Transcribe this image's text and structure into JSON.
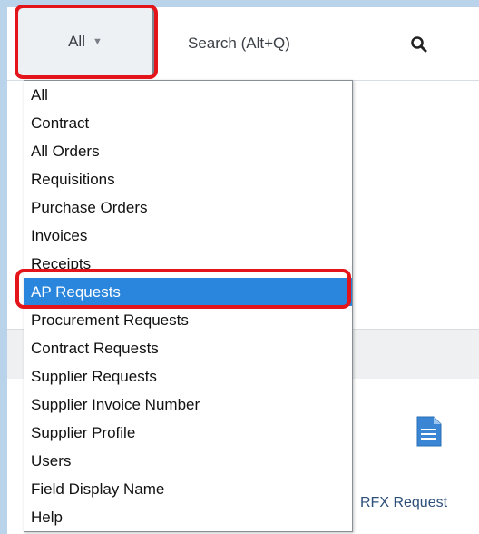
{
  "scope_selector": {
    "selected": "All",
    "caret": "▼"
  },
  "search": {
    "label": "Search (Alt+Q)",
    "icon": "search-icon"
  },
  "dropdown": {
    "items": [
      "All",
      "Contract",
      "All Orders",
      "Requisitions",
      "Purchase Orders",
      "Invoices",
      "Receipts",
      "AP Requests",
      "Procurement Requests",
      "Contract Requests",
      "Supplier Requests",
      "Supplier Invoice Number",
      "Supplier Profile",
      "Users",
      "Field Display Name",
      "Help"
    ],
    "selected": "AP Requests"
  },
  "background_tile": {
    "label": "RFX Request",
    "icon": "document-icon"
  },
  "colors": {
    "highlight": "#e4141b",
    "selected_bg": "#2a86dc",
    "frame": "#b9d3ea"
  }
}
